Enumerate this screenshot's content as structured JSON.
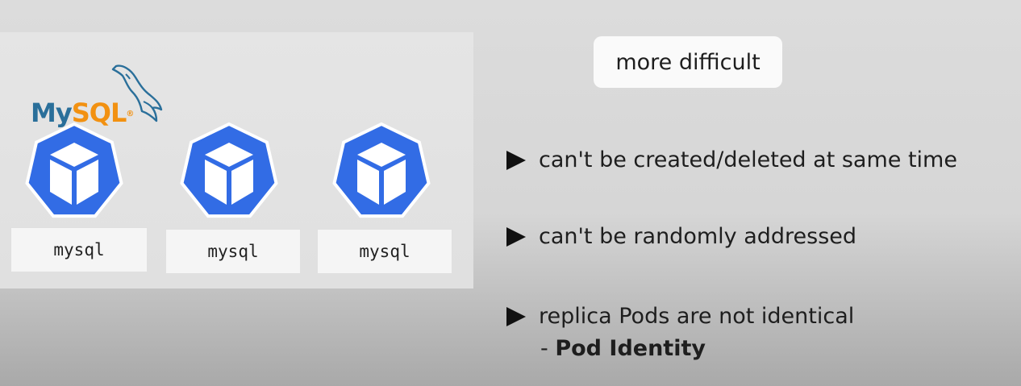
{
  "logo": {
    "my_text": "My",
    "sql_text": "SQL",
    "icon": "mysql-dolphin-logo",
    "colors": {
      "my": "#2a6f9a",
      "sql": "#f29111"
    }
  },
  "pods": [
    {
      "label": "mysql",
      "icon": "kubernetes-pod-icon"
    },
    {
      "label": "mysql",
      "icon": "kubernetes-pod-icon"
    },
    {
      "label": "mysql",
      "icon": "kubernetes-pod-icon"
    }
  ],
  "pod_color": "#326ce5",
  "badge": {
    "text": "more difficult"
  },
  "bullets": [
    {
      "text": "can't be created/deleted at same time"
    },
    {
      "text": "can't be randomly addressed"
    },
    {
      "text": "replica Pods are not identical"
    }
  ],
  "sub_bullet": {
    "prefix": "- ",
    "emphasis": "Pod Identity"
  }
}
